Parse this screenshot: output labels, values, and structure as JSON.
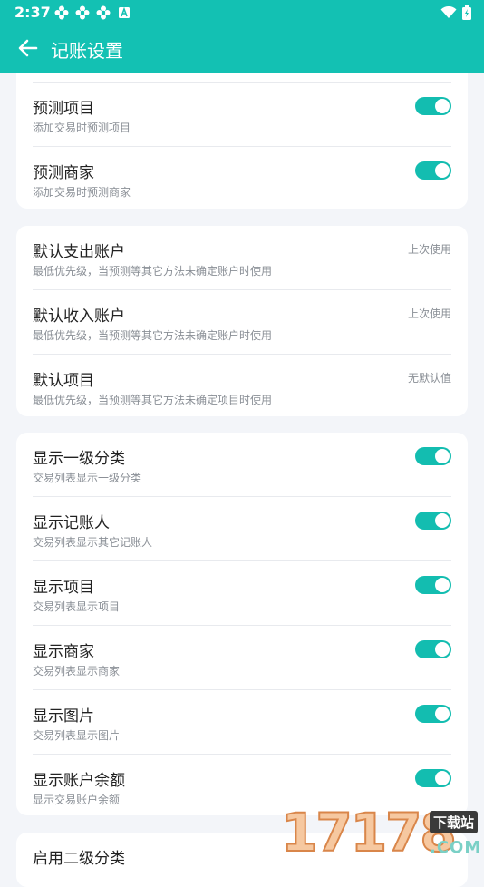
{
  "status_bar": {
    "time": "2:37",
    "icons": [
      "flower-icon",
      "flower-icon",
      "flower-icon",
      "a-icon",
      "wifi-icon",
      "battery-icon"
    ]
  },
  "app_bar": {
    "title": "记账设置",
    "back_icon": "arrow-left-icon"
  },
  "card1": {
    "items": [
      {
        "title": "预测项目",
        "desc": "添加交易时预测项目",
        "on": true
      },
      {
        "title": "预测商家",
        "desc": "添加交易时预测商家",
        "on": true
      }
    ]
  },
  "card2": {
    "items": [
      {
        "title": "默认支出账户",
        "desc": "最低优先级，当预测等其它方法未确定账户时使用",
        "value": "上次使用"
      },
      {
        "title": "默认收入账户",
        "desc": "最低优先级，当预测等其它方法未确定账户时使用",
        "value": "上次使用"
      },
      {
        "title": "默认项目",
        "desc": "最低优先级，当预测等其它方法未确定项目时使用",
        "value": "无默认值"
      }
    ]
  },
  "card3": {
    "items": [
      {
        "title": "显示一级分类",
        "desc": "交易列表显示一级分类",
        "on": true
      },
      {
        "title": "显示记账人",
        "desc": "交易列表显示其它记账人",
        "on": true
      },
      {
        "title": "显示项目",
        "desc": "交易列表显示项目",
        "on": true
      },
      {
        "title": "显示商家",
        "desc": "交易列表显示商家",
        "on": true
      },
      {
        "title": "显示图片",
        "desc": "交易列表显示图片",
        "on": true
      },
      {
        "title": "显示账户余额",
        "desc": "显示交易账户余额",
        "on": true
      }
    ]
  },
  "card4": {
    "items": [
      {
        "title": "启用二级分类"
      }
    ]
  },
  "watermark": {
    "brand": "17178",
    "tag": "下载站",
    "suffix": ".COM"
  },
  "colors": {
    "accent": "#13c1b3",
    "background": "#f3f5f9"
  }
}
